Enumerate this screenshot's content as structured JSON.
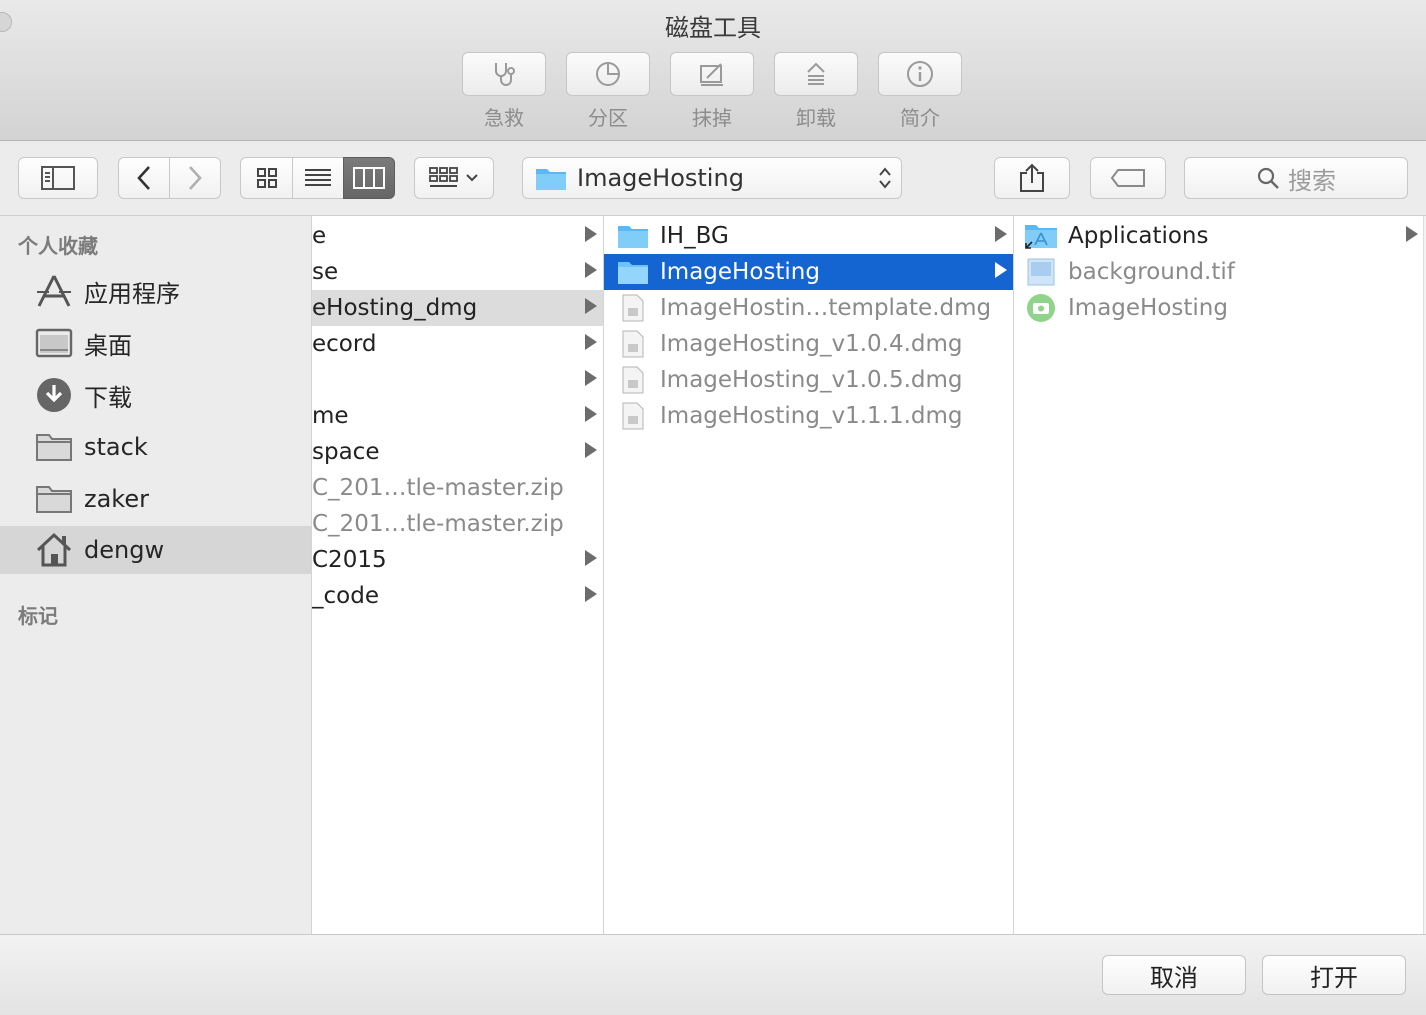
{
  "window": {
    "title": "磁盘工具"
  },
  "disk_toolbar": [
    {
      "label": "急救",
      "icon": "stethoscope-icon"
    },
    {
      "label": "分区",
      "icon": "pie-chart-icon"
    },
    {
      "label": "抹掉",
      "icon": "erase-icon"
    },
    {
      "label": "卸载",
      "icon": "eject-icon"
    },
    {
      "label": "简介",
      "icon": "info-icon"
    }
  ],
  "nav": {
    "path_popup": "ImageHosting",
    "search_placeholder": "搜索",
    "active_view": "column"
  },
  "sidebar": {
    "favorites_title": "个人收藏",
    "tags_title": "标记",
    "items": [
      {
        "label": "应用程序",
        "icon": "applications-icon"
      },
      {
        "label": "桌面",
        "icon": "desktop-icon"
      },
      {
        "label": "下载",
        "icon": "downloads-icon"
      },
      {
        "label": "stack",
        "icon": "folder-icon"
      },
      {
        "label": "zaker",
        "icon": "folder-icon"
      },
      {
        "label": "dengw",
        "icon": "home-icon",
        "selected": true
      }
    ]
  },
  "column1": [
    {
      "label": "e",
      "arrow": true
    },
    {
      "label": "se",
      "arrow": true
    },
    {
      "label": "eHosting_dmg",
      "arrow": true,
      "selected": true
    },
    {
      "label": "ecord",
      "arrow": true
    },
    {
      "label": "",
      "arrow": true
    },
    {
      "label": "me",
      "arrow": true
    },
    {
      "label": "space",
      "arrow": true
    },
    {
      "label": "C_201…tle-master.zip",
      "arrow": false,
      "dim": true
    },
    {
      "label": "C_201…tle-master.zip",
      "arrow": false,
      "dim": true
    },
    {
      "label": "C2015",
      "arrow": true
    },
    {
      "label": "_code",
      "arrow": true
    }
  ],
  "column2": [
    {
      "label": "IH_BG",
      "type": "folder",
      "arrow": true
    },
    {
      "label": "ImageHosting",
      "type": "folder",
      "arrow": true,
      "selected": true
    },
    {
      "label": "ImageHostin…template.dmg",
      "type": "dmg",
      "dim": true
    },
    {
      "label": "ImageHosting_v1.0.4.dmg",
      "type": "dmg",
      "dim": true
    },
    {
      "label": "ImageHosting_v1.0.5.dmg",
      "type": "dmg",
      "dim": true
    },
    {
      "label": "ImageHosting_v1.1.1.dmg",
      "type": "dmg",
      "dim": true
    }
  ],
  "column3": [
    {
      "label": "Applications",
      "type": "apps-alias",
      "arrow": true
    },
    {
      "label": "background.tif",
      "type": "image",
      "dim": true
    },
    {
      "label": "ImageHosting",
      "type": "app",
      "dim": true
    }
  ],
  "buttons": {
    "cancel": "取消",
    "open": "打开"
  }
}
